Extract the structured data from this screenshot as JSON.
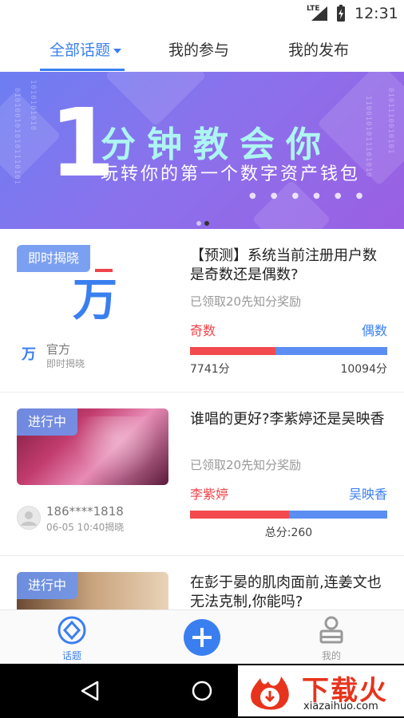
{
  "status_bar": {
    "network": "LTE",
    "time": "12:31"
  },
  "tabs": [
    {
      "label": "全部话题",
      "active": true
    },
    {
      "label": "我的参与",
      "active": false
    },
    {
      "label": "我的发布",
      "active": false
    }
  ],
  "banner": {
    "big_number": "1",
    "headline": "分钟教会你",
    "subline": "玩转你的第一个数字资产钱包",
    "page_count": 2,
    "active_page": 2
  },
  "topics": [
    {
      "status": "即时揭晓",
      "title": "【预测】系统当前注册用户数是奇数还是偶数?",
      "reward": "已领取20先知分奖励",
      "option_a": "奇数",
      "option_b": "偶数",
      "score_a": "7741分",
      "score_b": "10094分",
      "share_a": 0.434,
      "author": "官方",
      "author_sub": "即时揭晓",
      "thumb_logo": "万"
    },
    {
      "status": "进行中",
      "title": "谁唱的更好?李紫婷还是吴映香",
      "reward": "已领取20先知分奖励",
      "option_a": "李紫婷",
      "option_b": "吴映香",
      "total": "总分:260",
      "share_a": 0.5,
      "author": "186****1818",
      "author_sub": "06-05 10:40揭晓"
    },
    {
      "status": "进行中",
      "title": "在彭于晏的肌肉面前,连姜文也无法克制,你能吗?"
    }
  ],
  "bottom_nav": {
    "topics_label": "话题",
    "mine_label": "我的"
  },
  "watermark": {
    "text": "下载火",
    "url": "xiazaihuo.com"
  },
  "colors": {
    "accent": "#3a7ff0",
    "option_a": "#f24a4e",
    "option_b": "#5b8df2"
  }
}
